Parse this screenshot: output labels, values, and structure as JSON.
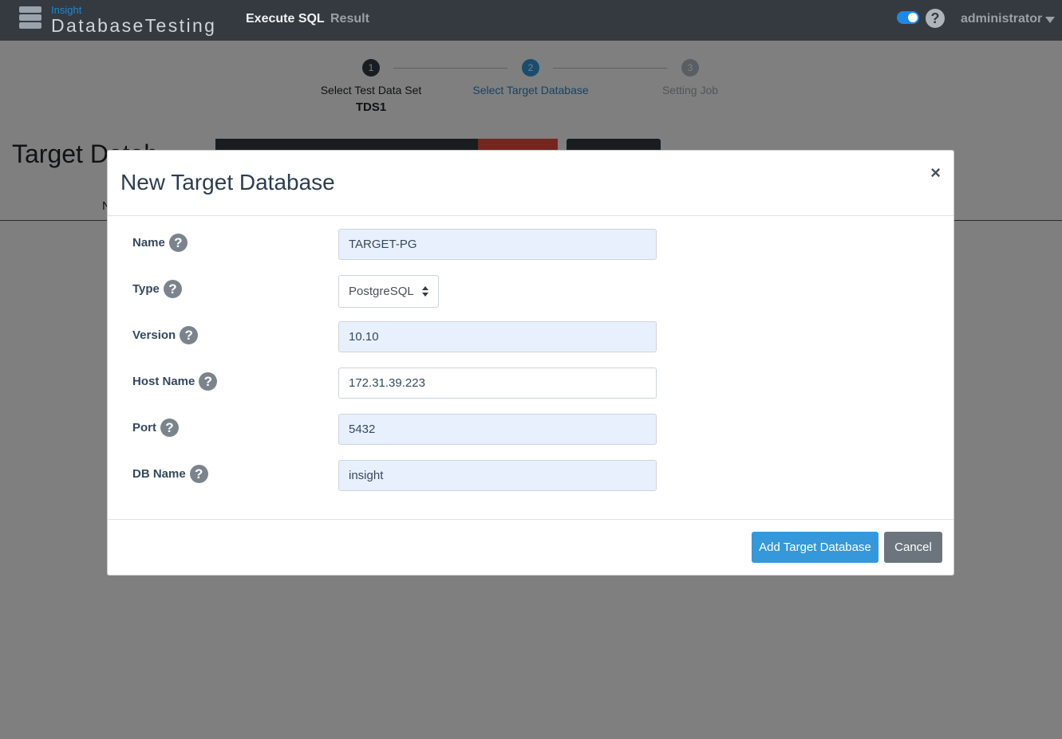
{
  "navbar": {
    "logo_small": "Insight",
    "logo_big": "DatabaseTesting",
    "links": [
      "Execute SQL",
      "Result"
    ],
    "help_symbol": "?",
    "user": "administrator"
  },
  "stepper": {
    "steps": [
      {
        "num": "1",
        "label": "Select Test Data Set",
        "sub": "TDS1"
      },
      {
        "num": "2",
        "label": "Select Target Database"
      },
      {
        "num": "3",
        "label": "Setting Job"
      }
    ]
  },
  "background": {
    "title": "Target Datab",
    "col_label": "N"
  },
  "modal": {
    "title": "New Target Database",
    "close_symbol": "×",
    "help_symbol": "?",
    "fields": [
      {
        "label": "Name",
        "value": "TARGET-PG"
      },
      {
        "label": "Type",
        "value": "PostgreSQL"
      },
      {
        "label": "Version",
        "value": "10.10"
      },
      {
        "label": "Host Name",
        "value": "172.31.39.223"
      },
      {
        "label": "Port",
        "value": "5432"
      },
      {
        "label": "DB Name",
        "value": "insight"
      }
    ],
    "submit_label": "Add Target Database",
    "cancel_label": "Cancel"
  },
  "colors": {
    "navbar": "#343a40",
    "primary": "#3498db",
    "secondary": "#6c757d",
    "danger": "#e74c3c",
    "autofill": "#e8f0fe"
  }
}
